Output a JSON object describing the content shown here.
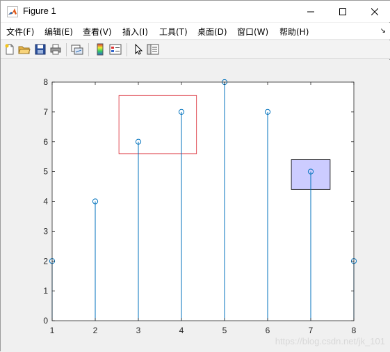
{
  "window": {
    "title": "Figure 1"
  },
  "menu": {
    "items": [
      "文件(F)",
      "编辑(E)",
      "查看(V)",
      "插入(I)",
      "工具(T)",
      "桌面(D)",
      "窗口(W)",
      "帮助(H)"
    ],
    "overflow": "↘"
  },
  "toolbar": {
    "buttons": [
      "new-figure-icon",
      "open-file-icon",
      "save-icon",
      "print-icon",
      "link-plot-icon",
      "insert-colorbar-icon",
      "insert-legend-icon",
      "edit-plot-pointer-icon",
      "property-inspector-icon"
    ]
  },
  "chart_data": {
    "type": "stem",
    "x": [
      1,
      2,
      3,
      4,
      5,
      6,
      7,
      8
    ],
    "y": [
      2,
      4,
      6,
      7,
      8,
      7,
      5,
      2
    ],
    "xlim": [
      1,
      8
    ],
    "ylim": [
      0,
      8
    ],
    "xticks": [
      "1",
      "2",
      "3",
      "4",
      "5",
      "6",
      "7",
      "8"
    ],
    "yticks": [
      "0",
      "1",
      "2",
      "3",
      "4",
      "5",
      "6",
      "7",
      "8"
    ],
    "series_color": "#0072bd",
    "annotations": [
      {
        "type": "rectangle",
        "x": [
          2.55,
          4.35
        ],
        "y": [
          5.6,
          7.55
        ],
        "edge_color": "#d9232e",
        "fill": "none"
      },
      {
        "type": "rectangle",
        "x": [
          6.55,
          7.45
        ],
        "y": [
          4.4,
          5.4
        ],
        "edge_color": "#000000",
        "fill": "#ccccff"
      }
    ],
    "grid": false,
    "box": true
  },
  "watermark": "https://blog.csdn.net/jk_101"
}
